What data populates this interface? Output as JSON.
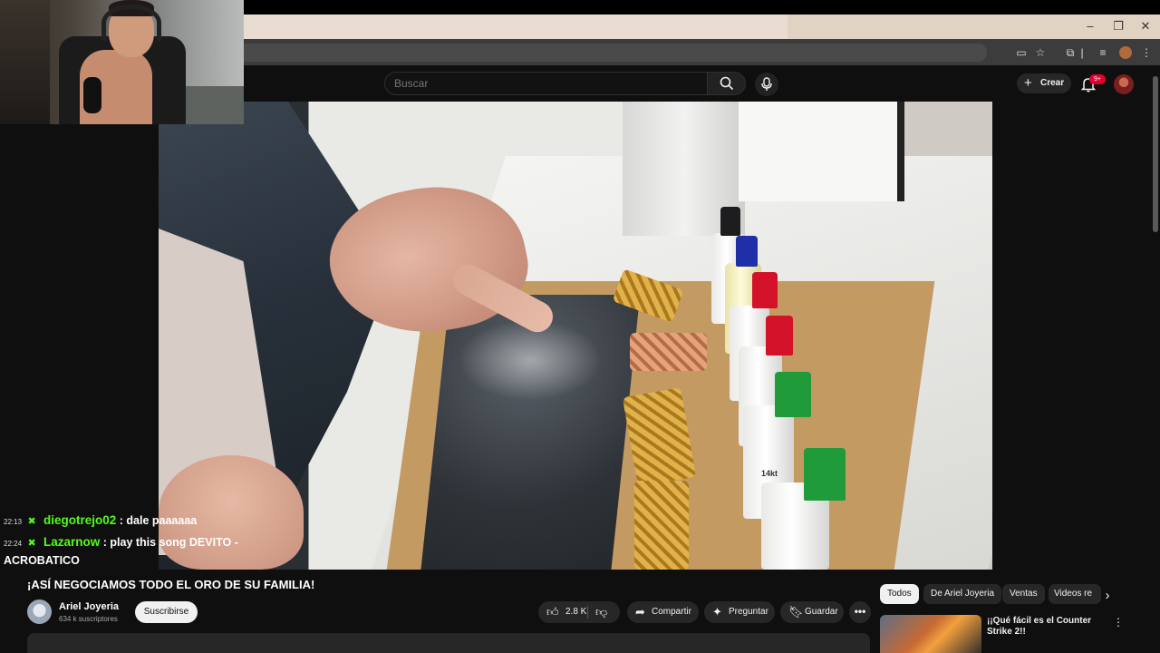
{
  "browser": {
    "window_controls": {
      "minimize": "–",
      "maximize": "❐",
      "close": "✕"
    },
    "toolbar_icons": [
      "cast-icon",
      "star-icon",
      "extensions-icon",
      "reading-list-icon",
      "profile-icon",
      "menu-icon"
    ]
  },
  "header": {
    "search_placeholder": "Buscar",
    "create_label": "Crear",
    "notifications_badge": "9+"
  },
  "chat": {
    "messages": [
      {
        "time": "22:13",
        "user": "diegotrejo02",
        "text": ": dale paaaaaa"
      },
      {
        "time": "22:24",
        "user": "Lazarnow",
        "text": ": play this song DEVITO -",
        "text_cont": "ACROBATICO"
      }
    ]
  },
  "video": {
    "title": "¡ASÍ NEGOCIAMOS TODO EL ORO DE SU FAMILIA!",
    "channel_name": "Ariel Joyeria",
    "subscribers": "634 k suscriptores",
    "subscribe_label": "Suscribirse",
    "likes": "2.8 K",
    "share_label": "Compartir",
    "ask_label": "Preguntar",
    "save_label": "Guardar",
    "more_label": "•••",
    "bottle_label": "14kt"
  },
  "sidebar": {
    "chips": [
      "Todos",
      "De Ariel Joyeria",
      "Ventas",
      "Videos re"
    ],
    "recommended_title": "¡¡Qué fácil es el Counter Strike 2!!"
  },
  "colors": {
    "background": "#0f0f0f",
    "chat_user": "#53fc18",
    "badge": "#e1002d"
  }
}
